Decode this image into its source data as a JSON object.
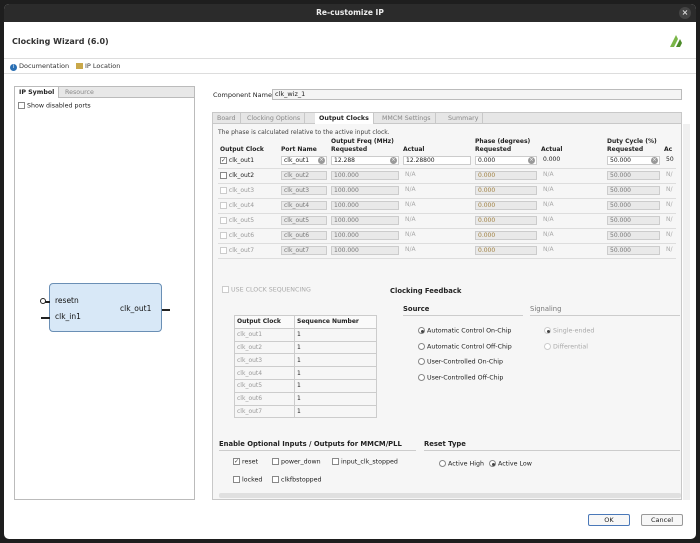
{
  "window": {
    "title": "Re-customize IP"
  },
  "header": {
    "title": "Clocking Wizard (6.0)"
  },
  "subbar": {
    "documentation": "Documentation",
    "ip_location": "IP Location"
  },
  "left_panel": {
    "tabs": [
      "IP Symbol",
      "Resource"
    ],
    "show_disabled_ports": "Show disabled ports",
    "symbol": {
      "inputs": [
        "resetn",
        "clk_in1"
      ],
      "outputs": [
        "clk_out1"
      ]
    }
  },
  "component": {
    "label": "Component Name",
    "value": "clk_wiz_1"
  },
  "tabs": [
    "Board",
    "Clocking Options",
    "Output Clocks",
    "MMCM Settings",
    "Summary"
  ],
  "active_tab": "Output Clocks",
  "note": "The phase is calculated relative to the active input clock.",
  "clock_table": {
    "group_headers": {
      "freq": "Output Freq (MHz)",
      "phase": "Phase (degrees)",
      "duty": "Duty Cycle (%)"
    },
    "headers": {
      "output_clock": "Output Clock",
      "port_name": "Port Name",
      "freq_requested": "Requested",
      "freq_actual": "Actual",
      "phase_requested": "Requested",
      "phase_actual": "Actual",
      "duty_requested": "Requested",
      "duty_actual": "Ac"
    },
    "rows": [
      {
        "name": "clk_out1",
        "port": "clk_out1",
        "freq_req": "12.288",
        "freq_act": "12.28800",
        "phase_req": "0.000",
        "phase_act": "0.000",
        "duty_req": "50.000",
        "duty_act": "50"
      },
      {
        "name": "clk_out2",
        "port": "clk_out2",
        "freq_req": "100.000",
        "freq_act": "N/A",
        "phase_req": "0.000",
        "phase_act": "N/A",
        "duty_req": "50.000",
        "duty_act": "N/"
      },
      {
        "name": "clk_out3",
        "port": "clk_out3",
        "freq_req": "100.000",
        "freq_act": "N/A",
        "phase_req": "0.000",
        "phase_act": "N/A",
        "duty_req": "50.000",
        "duty_act": "N/"
      },
      {
        "name": "clk_out4",
        "port": "clk_out4",
        "freq_req": "100.000",
        "freq_act": "N/A",
        "phase_req": "0.000",
        "phase_act": "N/A",
        "duty_req": "50.000",
        "duty_act": "N/"
      },
      {
        "name": "clk_out5",
        "port": "clk_out5",
        "freq_req": "100.000",
        "freq_act": "N/A",
        "phase_req": "0.000",
        "phase_act": "N/A",
        "duty_req": "50.000",
        "duty_act": "N/"
      },
      {
        "name": "clk_out6",
        "port": "clk_out6",
        "freq_req": "100.000",
        "freq_act": "N/A",
        "phase_req": "0.000",
        "phase_act": "N/A",
        "duty_req": "50.000",
        "duty_act": "N/"
      },
      {
        "name": "clk_out7",
        "port": "clk_out7",
        "freq_req": "100.000",
        "freq_act": "N/A",
        "phase_req": "0.000",
        "phase_act": "N/A",
        "duty_req": "50.000",
        "duty_act": "N/"
      }
    ]
  },
  "clock_sequencing": {
    "label": "USE CLOCK SEQUENCING"
  },
  "sequence_table": {
    "headers": {
      "clock": "Output Clock",
      "number": "Sequence Number"
    },
    "rows": [
      {
        "clock": "clk_out1",
        "number": "1"
      },
      {
        "clock": "clk_out2",
        "number": "1"
      },
      {
        "clock": "clk_out3",
        "number": "1"
      },
      {
        "clock": "clk_out4",
        "number": "1"
      },
      {
        "clock": "clk_out5",
        "number": "1"
      },
      {
        "clock": "clk_out6",
        "number": "1"
      },
      {
        "clock": "clk_out7",
        "number": "1"
      }
    ]
  },
  "feedback": {
    "title": "Clocking Feedback",
    "source_title": "Source",
    "source_options": [
      "Automatic Control On-Chip",
      "Automatic Control Off-Chip",
      "User-Controlled On-Chip",
      "User-Controlled Off-Chip"
    ],
    "source_selected": 0,
    "signaling_title": "Signaling",
    "signaling_options": [
      "Single-ended",
      "Differential"
    ]
  },
  "optional_io": {
    "title": "Enable Optional Inputs / Outputs for MMCM/PLL",
    "row1": [
      "reset",
      "power_down",
      "input_clk_stopped"
    ],
    "row2": [
      "locked",
      "clkfbstopped"
    ]
  },
  "reset_type": {
    "title": "Reset Type",
    "options": [
      "Active High",
      "Active Low"
    ],
    "selected": 1
  },
  "buttons": {
    "ok": "OK",
    "cancel": "Cancel"
  },
  "colors": {
    "accent": "#4a78b8",
    "symbol_fill": "#d8e8f7",
    "titlebar": "#2b2b2b"
  }
}
